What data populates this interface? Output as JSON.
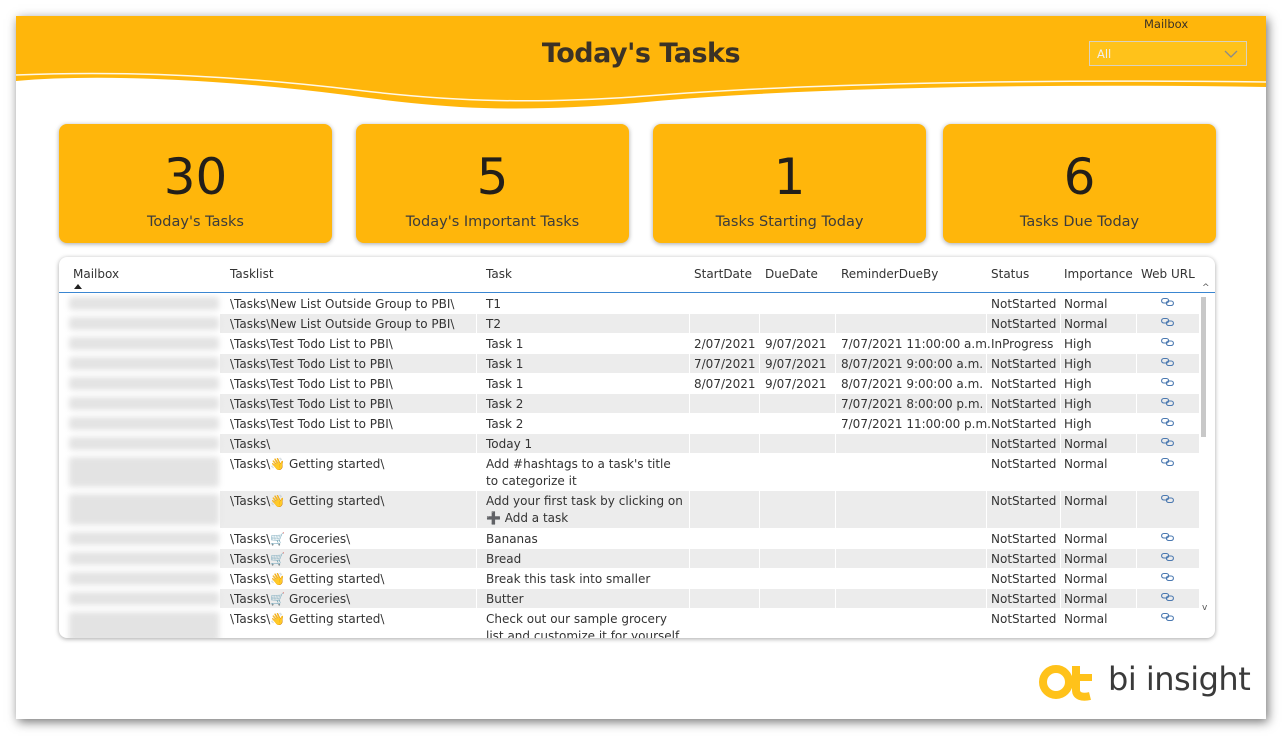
{
  "header": {
    "title": "Today's Tasks",
    "slicer_label": "Mailbox",
    "slicer_value": "All",
    "accent": "#ffb60b"
  },
  "kpis": [
    {
      "value": "30",
      "label": "Today's Tasks"
    },
    {
      "value": "5",
      "label": "Today's Important Tasks"
    },
    {
      "value": "1",
      "label": "Tasks Starting Today"
    },
    {
      "value": "6",
      "label": "Tasks Due Today"
    }
  ],
  "table": {
    "columns": [
      "Mailbox",
      "Tasklist",
      "Task",
      "StartDate",
      "DueDate",
      "ReminderDueBy",
      "Status",
      "Importance",
      "Web URL"
    ],
    "sorted_column": "Mailbox",
    "rows": [
      {
        "tasklist": "\\Tasks\\New List Outside Group to PBI\\",
        "task": "T1",
        "start": "",
        "due": "",
        "reminder": "",
        "status": "NotStarted",
        "importance": "Normal"
      },
      {
        "tasklist": "\\Tasks\\New List Outside Group to PBI\\",
        "task": "T2",
        "start": "",
        "due": "",
        "reminder": "",
        "status": "NotStarted",
        "importance": "Normal"
      },
      {
        "tasklist": "\\Tasks\\Test Todo List to PBI\\",
        "task": "Task 1",
        "start": "2/07/2021",
        "due": "9/07/2021",
        "reminder": "7/07/2021 11:00:00 a.m.",
        "status": "InProgress",
        "importance": "High"
      },
      {
        "tasklist": "\\Tasks\\Test Todo List to PBI\\",
        "task": "Task 1",
        "start": "7/07/2021",
        "due": "9/07/2021",
        "reminder": "8/07/2021 9:00:00 a.m.",
        "status": "NotStarted",
        "importance": "High"
      },
      {
        "tasklist": "\\Tasks\\Test Todo List to PBI\\",
        "task": "Task 1",
        "start": "8/07/2021",
        "due": "9/07/2021",
        "reminder": "8/07/2021 9:00:00 a.m.",
        "status": "NotStarted",
        "importance": "High"
      },
      {
        "tasklist": "\\Tasks\\Test Todo List to PBI\\",
        "task": "Task 2",
        "start": "",
        "due": "",
        "reminder": "7/07/2021 8:00:00 p.m.",
        "status": "NotStarted",
        "importance": "High"
      },
      {
        "tasklist": "\\Tasks\\Test Todo List to PBI\\",
        "task": "Task 2",
        "start": "",
        "due": "",
        "reminder": "7/07/2021 11:00:00 p.m.",
        "status": "NotStarted",
        "importance": "High"
      },
      {
        "tasklist": "\\Tasks\\",
        "task": "Today 1",
        "start": "",
        "due": "",
        "reminder": "",
        "status": "NotStarted",
        "importance": "Normal"
      },
      {
        "tasklist": "\\Tasks\\👋 Getting started\\",
        "task": "Add #hashtags to a task's title to categorize it",
        "start": "",
        "due": "",
        "reminder": "",
        "status": "NotStarted",
        "importance": "Normal"
      },
      {
        "tasklist": "\\Tasks\\👋 Getting started\\",
        "task": "Add your first task by clicking on ➕ Add a task",
        "start": "",
        "due": "",
        "reminder": "",
        "status": "NotStarted",
        "importance": "Normal"
      },
      {
        "tasklist": "\\Tasks\\🛒 Groceries\\",
        "task": "Bananas",
        "start": "",
        "due": "",
        "reminder": "",
        "status": "NotStarted",
        "importance": "Normal"
      },
      {
        "tasklist": "\\Tasks\\🛒 Groceries\\",
        "task": "Bread",
        "start": "",
        "due": "",
        "reminder": "",
        "status": "NotStarted",
        "importance": "Normal"
      },
      {
        "tasklist": "\\Tasks\\👋 Getting started\\",
        "task": "Break this task into smaller steps",
        "start": "",
        "due": "",
        "reminder": "",
        "status": "NotStarted",
        "importance": "Normal"
      },
      {
        "tasklist": "\\Tasks\\🛒 Groceries\\",
        "task": "Butter",
        "start": "",
        "due": "",
        "reminder": "",
        "status": "NotStarted",
        "importance": "Normal"
      },
      {
        "tasklist": "\\Tasks\\👋 Getting started\\",
        "task": "Check out our sample grocery list and customize it for yourself",
        "start": "",
        "due": "",
        "reminder": "",
        "status": "NotStarted",
        "importance": "Normal"
      }
    ]
  },
  "logo": {
    "text": "bi insight"
  }
}
